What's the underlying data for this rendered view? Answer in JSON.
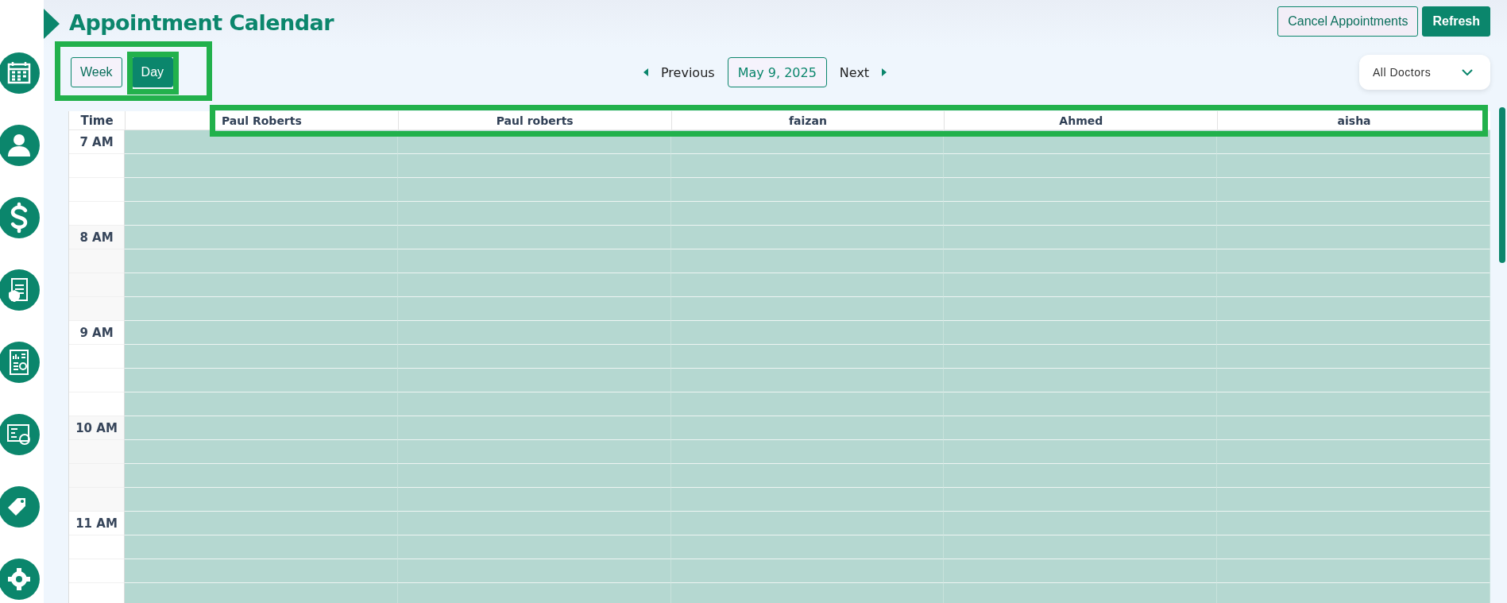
{
  "title": "Appointment Calendar",
  "header_buttons": [
    {
      "label": "Cancel Appointments",
      "kind": "outline"
    },
    {
      "label": "Refresh",
      "kind": "solid"
    }
  ],
  "view_toggle": [
    {
      "label": "Week",
      "selected": false
    },
    {
      "label": "Day",
      "selected": true
    }
  ],
  "nav": {
    "previous": "Previous",
    "date": "May 9, 2025",
    "next": "Next"
  },
  "doctor_filter": {
    "value": "All Doctors"
  },
  "table": {
    "time_heading": "Time",
    "doctors": [
      "Paul Roberts",
      "Paul roberts",
      "faizan",
      "Ahmed",
      "aisha"
    ],
    "hours": [
      "7 AM",
      "8 AM",
      "9 AM",
      "10 AM",
      "11 AM"
    ]
  }
}
